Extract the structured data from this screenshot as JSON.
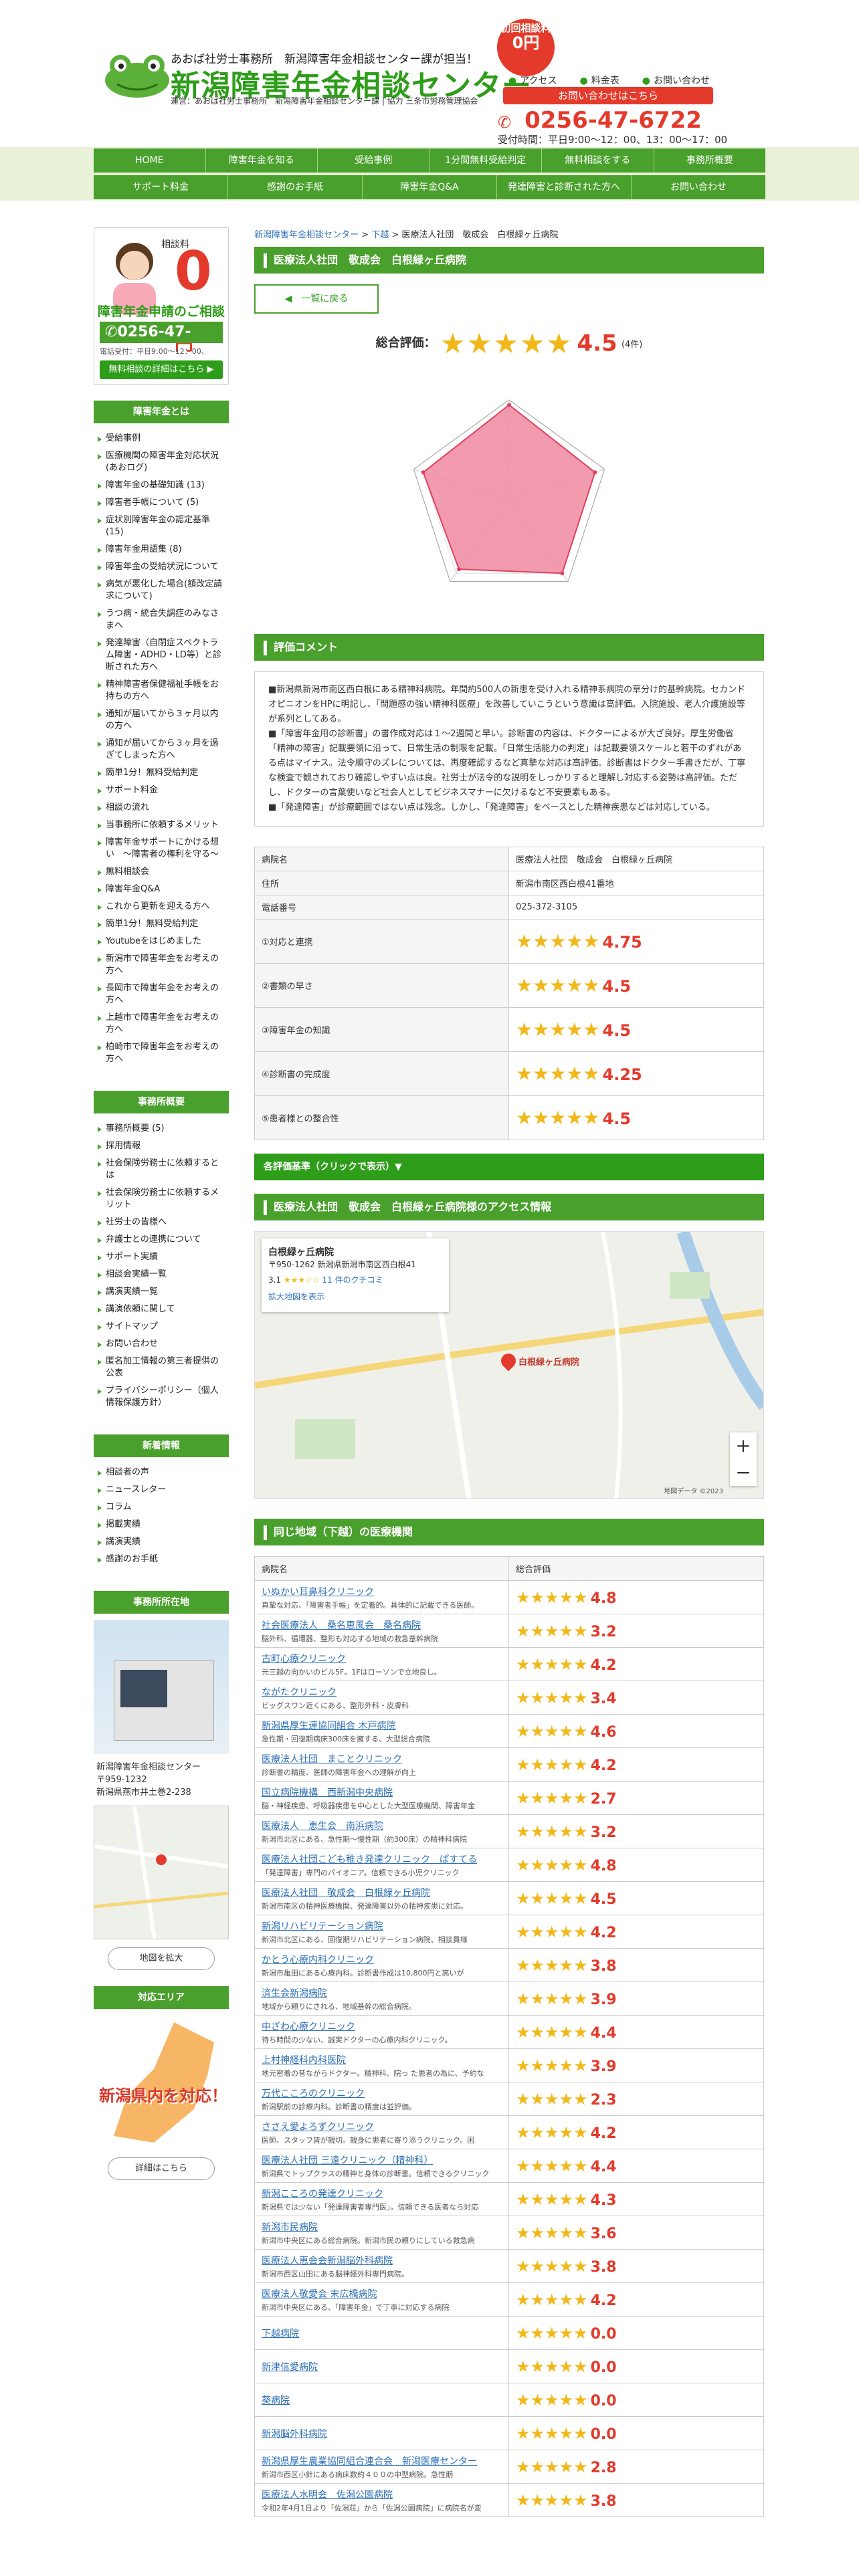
{
  "header": {
    "tagline": "あおば社労士事務所　新潟障害年金相談センター課が担当！",
    "site_title": "新潟障害年金相談センター",
    "operator": "運営：あおば社労士事務所　新潟障害年金相談センター課 | 協力 三条市労務管理協会",
    "badge_line1": "初回相談料",
    "badge_line2": "0円",
    "util_links": [
      "アクセス",
      "料金表",
      "お問い合わせ"
    ],
    "contact_button": "お問い合わせはこちら",
    "phone": "0256-47-6722",
    "hours": "受付時間：平日9:00～12：00、13：00～17：00"
  },
  "nav": {
    "row1": [
      "HOME",
      "障害年金を知る",
      "受給事例",
      "1分間無料受給判定",
      "無料相談をする",
      "事務所概要"
    ],
    "row2": [
      "サポート料金",
      "感謝のお手紙",
      "障害年金Q&A",
      "発達障害と診断された方へ",
      "お問い合わせ"
    ]
  },
  "sidebar": {
    "promo": {
      "label": "相談料",
      "zero": "0",
      "yen": "円",
      "title": "障害年金申請のご相談",
      "phone": "0256-47-6722",
      "hours": "電話受付：平日9:00～12：00、",
      "button": "無料相談の詳細はこちら ▶"
    },
    "section1_title": "障害年金とは",
    "section1_items": [
      "受給事例",
      "医療機関の障害年金対応状況(あおログ)",
      "障害年金の基礎知識 (13)",
      "障害者手帳について (5)",
      "症状別障害年金の認定基準 (15)",
      "障害年金用語集 (8)",
      "障害年金の受給状況について",
      "病気が悪化した場合(額改定請求について)",
      "うつ病・統合失調症のみなさまへ",
      "発達障害（自閉症スペクトラム障害・ADHD・LD等）と診断された方へ",
      "精神障害者保健福祉手帳をお持ちの方へ",
      "通知が届いてから３ヶ月以内の方へ",
      "通知が届いてから３ヶ月を過ぎてしまった方へ",
      "簡単1分！無料受給判定",
      "サポート料金",
      "相談の流れ",
      "当事務所に依頼するメリット",
      "障害年金サポートにかける想い　〜障害者の権利を守る〜",
      "無料相談会",
      "障害年金Q&A",
      "これから更新を迎える方へ",
      "簡単1分！無料受給判定",
      "Youtubeをはじめました",
      "新潟市で障害年金をお考えの方へ",
      "長岡市で障害年金をお考えの方へ",
      "上越市で障害年金をお考えの方へ",
      "柏崎市で障害年金をお考えの方へ"
    ],
    "section2_title": "事務所概要",
    "section2_items": [
      "事務所概要 (5)",
      "採用情報",
      "社会保険労務士に依頼するとは",
      "社会保険労務士に依頼するメリット",
      "社労士の皆様へ",
      "弁護士との連携について",
      "サポート実績",
      "相談会実績一覧",
      "講演実績一覧",
      "講演依頼に関して",
      "サイトマップ",
      "お問い合わせ",
      "匿名加工情報の第三者提供の公表",
      "プライバシーポリシー（個人情報保護方針）"
    ],
    "section3_title": "新着情報",
    "section3_items": [
      "相談者の声",
      "ニュースレター",
      "コラム",
      "掲載実績",
      "講演実績",
      "感謝のお手紙"
    ],
    "section4_title": "事務所所在地",
    "office_name": "新潟障害年金相談センター",
    "office_zip": "〒959-1232",
    "office_addr": "新潟県燕市井土巻2-238",
    "map_button": "地図を拡大",
    "section5_title": "対応エリア",
    "area_text": "新潟県内を対応！",
    "area_button": "詳細はこちら"
  },
  "main": {
    "breadcrumb_home": "新潟障害年金相談センター",
    "breadcrumb_mid": "下越",
    "breadcrumb_current": "医療法人社団　敬成会　白根緑ヶ丘病院",
    "title": "医療法人社団　敬成会　白根緑ヶ丘病院",
    "back_button": "一覧に戻る",
    "overall_label": "総合評価：",
    "overall_score": "4.5",
    "overall_count": "(4件)",
    "comment_title": "評価コメント",
    "comments": [
      "■新潟県新潟市南区西白根にある精神科病院。年間約500人の新患を受け入れる精神系病院の草分け的基幹病院。セカンドオピニオンをHPに明記し、「問題感の強い精神科医療」を改善していこうという意識は高評価。入院施設、老人介護施設等が系列としてある。",
      "■「障害年金用の診断書」の書作成対応は１～2週間と早い。診断書の内容は、ドクターによるが大ざ良好。厚生労働省「精神の障害」記載要領に沿って、日常生活の制限を記載。「日常生活能力の判定」は記載要領スケールと若干のずれがある点はマイナス。法令順守のズレについては、再度確認するなど真摯な対応は高評価。診断書はドクター手書きだが、丁寧な検査で観されており確認しやすい点は良。社労士が法令的な説明をしっかりすると理解し対応する姿勢は高評価。ただし、ドクターの言葉使いなど社会人としてビジネスマナーに欠けるなど不安要素もある。",
      "■「発達障害」が診療範囲ではない点は残念。しかし、「発達障害」をベースとした精神疾患などは対応している。"
    ],
    "info_rows": [
      {
        "k": "病院名",
        "v": "医療法人社団　敬成会　白根緑ヶ丘病院"
      },
      {
        "k": "住所",
        "v": "新潟市南区西白根41番地"
      },
      {
        "k": "電話番号",
        "v": "025-372-3105"
      }
    ],
    "score_rows": [
      {
        "k": "①対応と連携",
        "v": "4.75"
      },
      {
        "k": "②書類の早さ",
        "v": "4.5"
      },
      {
        "k": "③障害年金の知識",
        "v": "4.5"
      },
      {
        "k": "④診断書の完成度",
        "v": "4.25"
      },
      {
        "k": "⑤患者様との整合性",
        "v": "4.5"
      }
    ],
    "criteria_toggle": "各評価基準（クリックで表示）▼",
    "access_title": "医療法人社団　敬成会　白根緑ヶ丘病院様のアクセス情報",
    "map_card_name": "白根緑ヶ丘病院",
    "map_card_addr": "〒950-1262 新潟県新潟市南区西白根41",
    "map_card_rating": "3.1",
    "map_card_reviews": "11 件のクチコミ",
    "map_card_link": "拡大地図を表示",
    "map_pin_label": "白根緑ヶ丘病院",
    "map_footer": "地図データ ©2023",
    "nearby_title": "同じ地域（下越）の医療機関",
    "nearby_head_name": "病院名",
    "nearby_head_score": "総合評価",
    "nearby": [
      {
        "name": "いぬかい耳鼻科クリニック",
        "desc": "真摯な対応、「障害者手帳」を定着的。具体的に記載できる医師。",
        "score": "4.8",
        "stars": 5
      },
      {
        "name": "社会医療法人　桑名恵風会　桑名病院",
        "desc": "脳外科、循環器、整形も対応する地域の救急基幹病院",
        "score": "3.2",
        "stars": 3
      },
      {
        "name": "古町心療クリニック",
        "desc": "元三越の向かいのビル5F。1Fはローソンで立地良し。",
        "score": "4.2",
        "stars": 4
      },
      {
        "name": "ながたクリニック",
        "desc": "ビッグスワン近くにある、整形外科・皮膚科",
        "score": "3.4",
        "stars": 3
      },
      {
        "name": "新潟県厚生連協同組合 木戸病院",
        "desc": "急性期・回復期病床300床を擁する、大型総合病院",
        "score": "4.6",
        "stars": 5
      },
      {
        "name": "医療法人社団　まことクリニック",
        "desc": "診断書の精度、医師の障害年金への理解が向上",
        "score": "4.2",
        "stars": 4
      },
      {
        "name": "国立病院機構　西新潟中央病院",
        "desc": "脳・神経疾患、呼吸器疾患を中心とした大型医療機関、障害年金",
        "score": "2.7",
        "stars": 3
      },
      {
        "name": "医療法人　恵生会　南浜病院",
        "desc": "新潟市北区にある、急性期〜慢性期（約300床）の精神科病院",
        "score": "3.2",
        "stars": 3
      },
      {
        "name": "医療法人社団こども稚き発達クリニック　ぱすてる",
        "desc": "「発達障害」専門のパイオニア。信頼できる小児クリニック",
        "score": "4.8",
        "stars": 5
      },
      {
        "name": "医療法人社団　敬成会　白根緑ヶ丘病院",
        "desc": "新潟市南区の精神医療機関、発達障害以外の精神疾患に対応。",
        "score": "4.5",
        "stars": 5
      },
      {
        "name": "新潟リハビリテーション病院",
        "desc": "新潟市北区にある、回復期リハビリテーション病院、相談員様",
        "score": "4.2",
        "stars": 4
      },
      {
        "name": "かとう心療内科クリニック",
        "desc": "新潟市亀田にある心療内科。診断書作成は10,800円と高いが",
        "score": "3.8",
        "stars": 4
      },
      {
        "name": "済生会新潟病院",
        "desc": "地域から頼りにされる、地域基幹の総合病院。",
        "score": "3.9",
        "stars": 4
      },
      {
        "name": "中ざわ心療クリニック",
        "desc": "待ち時間の少ない、誠実ドクターの心療内科クリニック。",
        "score": "4.4",
        "stars": 4
      },
      {
        "name": "上村神経科内科医院",
        "desc": "地元密着の昔ながらドクター。精神科、院っ た患者の為に、予約な",
        "score": "3.9",
        "stars": 4
      },
      {
        "name": "万代こころのクリニック",
        "desc": "新潟駅前の診療内科。診断書の精度は並評価。",
        "score": "2.3",
        "stars": 2
      },
      {
        "name": "ささえ愛よろずクリニック",
        "desc": "医師、スタッフ皆が親切。親身に患者に寄り添うクリニック。困",
        "score": "4.2",
        "stars": 4
      },
      {
        "name": "医療法人社団 三遠クリニック（精神科）",
        "desc": "新潟県でトップクラスの精神と身体の診断書。信頼できるクリニック",
        "score": "4.4",
        "stars": 4
      },
      {
        "name": "新潟こころの発達クリニック",
        "desc": "新潟県では少ない「発達障害者専門医」。信頼できる医者なら対応",
        "score": "4.3",
        "stars": 4
      },
      {
        "name": "新潟市民病院",
        "desc": "新潟市中央区にある総合病院。新潟市民の頼りにしている救急病",
        "score": "3.6",
        "stars": 4
      },
      {
        "name": "医療法人恵会会新潟脳外科病院",
        "desc": "新潟市西区山田にある脳神経外科専門病院。",
        "score": "3.8",
        "stars": 4
      },
      {
        "name": "医療法人敬愛会 末広橋病院",
        "desc": "新潟市中央区にある、「障害年金」で丁寧に対応する病院",
        "score": "4.2",
        "stars": 4
      },
      {
        "name": "下越病院",
        "desc": "",
        "score": "0.0",
        "stars": 0
      },
      {
        "name": "新津信愛病院",
        "desc": "",
        "score": "0.0",
        "stars": 0
      },
      {
        "name": "葵病院",
        "desc": "",
        "score": "0.0",
        "stars": 0
      },
      {
        "name": "新潟脳外科病院",
        "desc": "",
        "score": "0.0",
        "stars": 0
      },
      {
        "name": "新潟県厚生農業協同組合連合会　新潟医療センター",
        "desc": "新潟市西区小針にある病床数約４００の中型病院。急性期",
        "score": "2.8",
        "stars": 3
      },
      {
        "name": "医療法人水明会　佐潟公園病院",
        "desc": "令和2年4月1日より「佐潟荘」から「佐潟公園病院」に病院名が変",
        "score": "3.8",
        "stars": 4
      }
    ]
  },
  "radar": {
    "labels": [
      "①対応と連携",
      "②書類の早さ",
      "③障害年金の知識",
      "④診断書の完成度",
      "⑤患者様との整合性"
    ],
    "values": [
      4.75,
      4.5,
      4.5,
      4.25,
      4.5
    ],
    "max": 5,
    "fill": "#f08aa0",
    "stroke": "#e0405f"
  },
  "colors": {
    "accent_green": "#4aa02c",
    "title_green": "#2e9d1a",
    "red": "#e43a2b",
    "star": "#f2b81a"
  }
}
